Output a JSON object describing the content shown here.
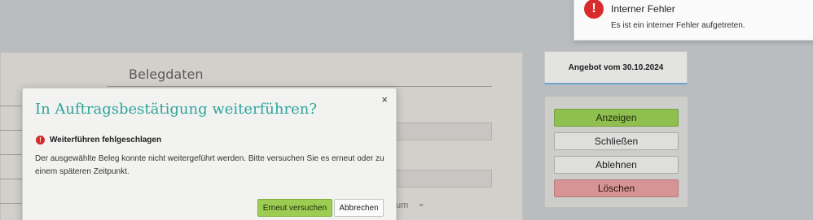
{
  "background": {
    "section_title": "Belegdaten",
    "field_fragment": "um",
    "dropdown_chevron": "⌄"
  },
  "offer": {
    "label": "Angebot vom 30.10.2024"
  },
  "actions": {
    "show": "Anzeigen",
    "close": "Schließen",
    "reject": "Ablehnen",
    "delete": "Löschen"
  },
  "toast": {
    "title": "Interner Fehler",
    "message": "Es ist ein interner Fehler aufgetreten.",
    "icon": "exclamation-circle-icon"
  },
  "modal": {
    "title": "In Auftragsbestätigung weiterführen?",
    "close_glyph": "×",
    "error_title": "Weiterführen fehlgeschlagen",
    "error_message": "Der ausgewählte Beleg konnte nicht weitergeführt werden. Bitte versuchen Sie es erneut oder zu einem späteren Zeitpunkt.",
    "retry_label": "Erneut versuchen",
    "cancel_label": "Abbrechen"
  },
  "colors": {
    "accent_teal": "#2ea59c",
    "success_green": "#8fbf4f",
    "danger_red": "#d82c2c"
  }
}
